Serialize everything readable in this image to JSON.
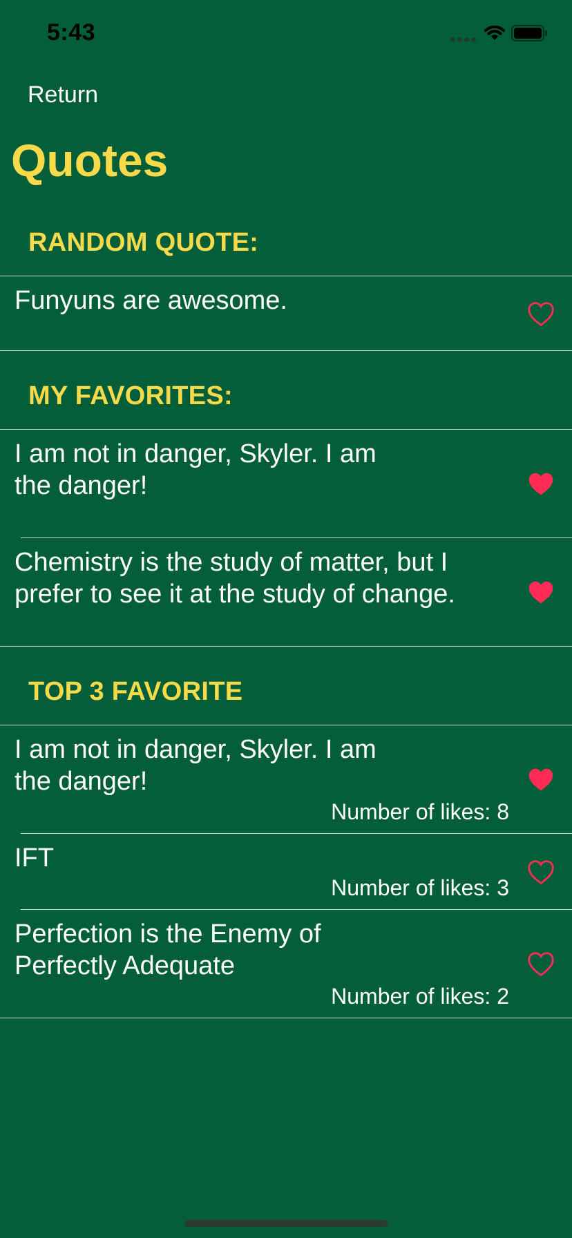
{
  "status_bar": {
    "time": "5:43"
  },
  "nav": {
    "return_label": "Return"
  },
  "page": {
    "title": "Quotes"
  },
  "colors": {
    "background": "#055E3A",
    "accent_yellow": "#F6DA4A",
    "heart_red": "#FF2D55",
    "text": "#FFFFFF"
  },
  "sections": {
    "random": {
      "header": "RANDOM QUOTE:",
      "items": [
        {
          "text": "Funyuns are awesome.",
          "favorited": false
        }
      ]
    },
    "favorites": {
      "header": "MY FAVORITES:",
      "items": [
        {
          "line1": "I am not in danger, Skyler. I am",
          "line2": "the danger!",
          "favorited": true
        },
        {
          "line1": "Chemistry is the study of matter, but I",
          "line2": "prefer to see it at the study of change.",
          "favorited": true
        }
      ]
    },
    "top3": {
      "header": "TOP 3 FAVORITE",
      "items": [
        {
          "line1": "I am not in danger, Skyler. I am",
          "line2": "the danger!",
          "likes": "Number of likes: 8",
          "favorited": true
        },
        {
          "line1": "IFT",
          "likes": "Number of likes: 3",
          "favorited": false
        },
        {
          "line1": "Perfection is the Enemy of",
          "line2": "Perfectly Adequate",
          "likes": "Number of likes: 2",
          "favorited": false
        }
      ]
    }
  },
  "icons": {
    "heart_filled": "heart-filled-icon",
    "heart_outline": "heart-outline-icon",
    "wifi": "wifi-icon",
    "battery": "battery-icon"
  }
}
